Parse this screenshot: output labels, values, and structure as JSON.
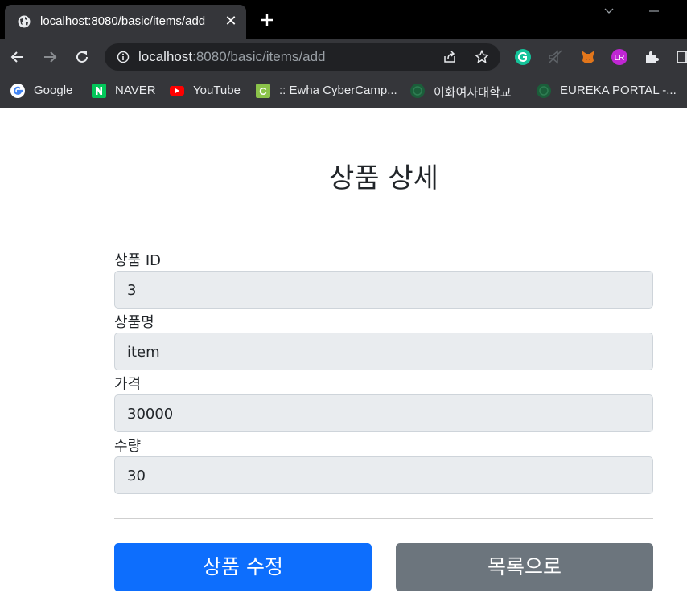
{
  "browser": {
    "tab_title": "localhost:8080/basic/items/add",
    "url_host": "localhost",
    "url_rest": ":8080/basic/items/add",
    "accent_dark": "#35363a",
    "bookmarks": [
      {
        "label": "Google",
        "icon": "google-icon",
        "color": "#4285f4"
      },
      {
        "label": "NAVER",
        "icon": "naver-icon",
        "color": "#03c75a"
      },
      {
        "label": "YouTube",
        "icon": "youtube-icon",
        "color": "#ff0000"
      },
      {
        "label": ":: Ewha CyberCamp...",
        "icon": "cybercamp-icon",
        "color": "#8bc34a"
      },
      {
        "label": "이화여자대학교",
        "icon": "ewha-icon",
        "color": "#1b5e3a"
      },
      {
        "label": "EUREKA PORTAL -...",
        "icon": "eureka-icon",
        "color": "#1b5e3a"
      }
    ]
  },
  "page": {
    "title": "상품 상세",
    "fields": [
      {
        "label": "상품 ID",
        "value": "3"
      },
      {
        "label": "상품명",
        "value": "item"
      },
      {
        "label": "가격",
        "value": "30000"
      },
      {
        "label": "수량",
        "value": "30"
      }
    ],
    "edit_button": "상품 수정",
    "list_button": "목록으로",
    "primary_color": "#0d6efd",
    "secondary_color": "#6c757d"
  }
}
